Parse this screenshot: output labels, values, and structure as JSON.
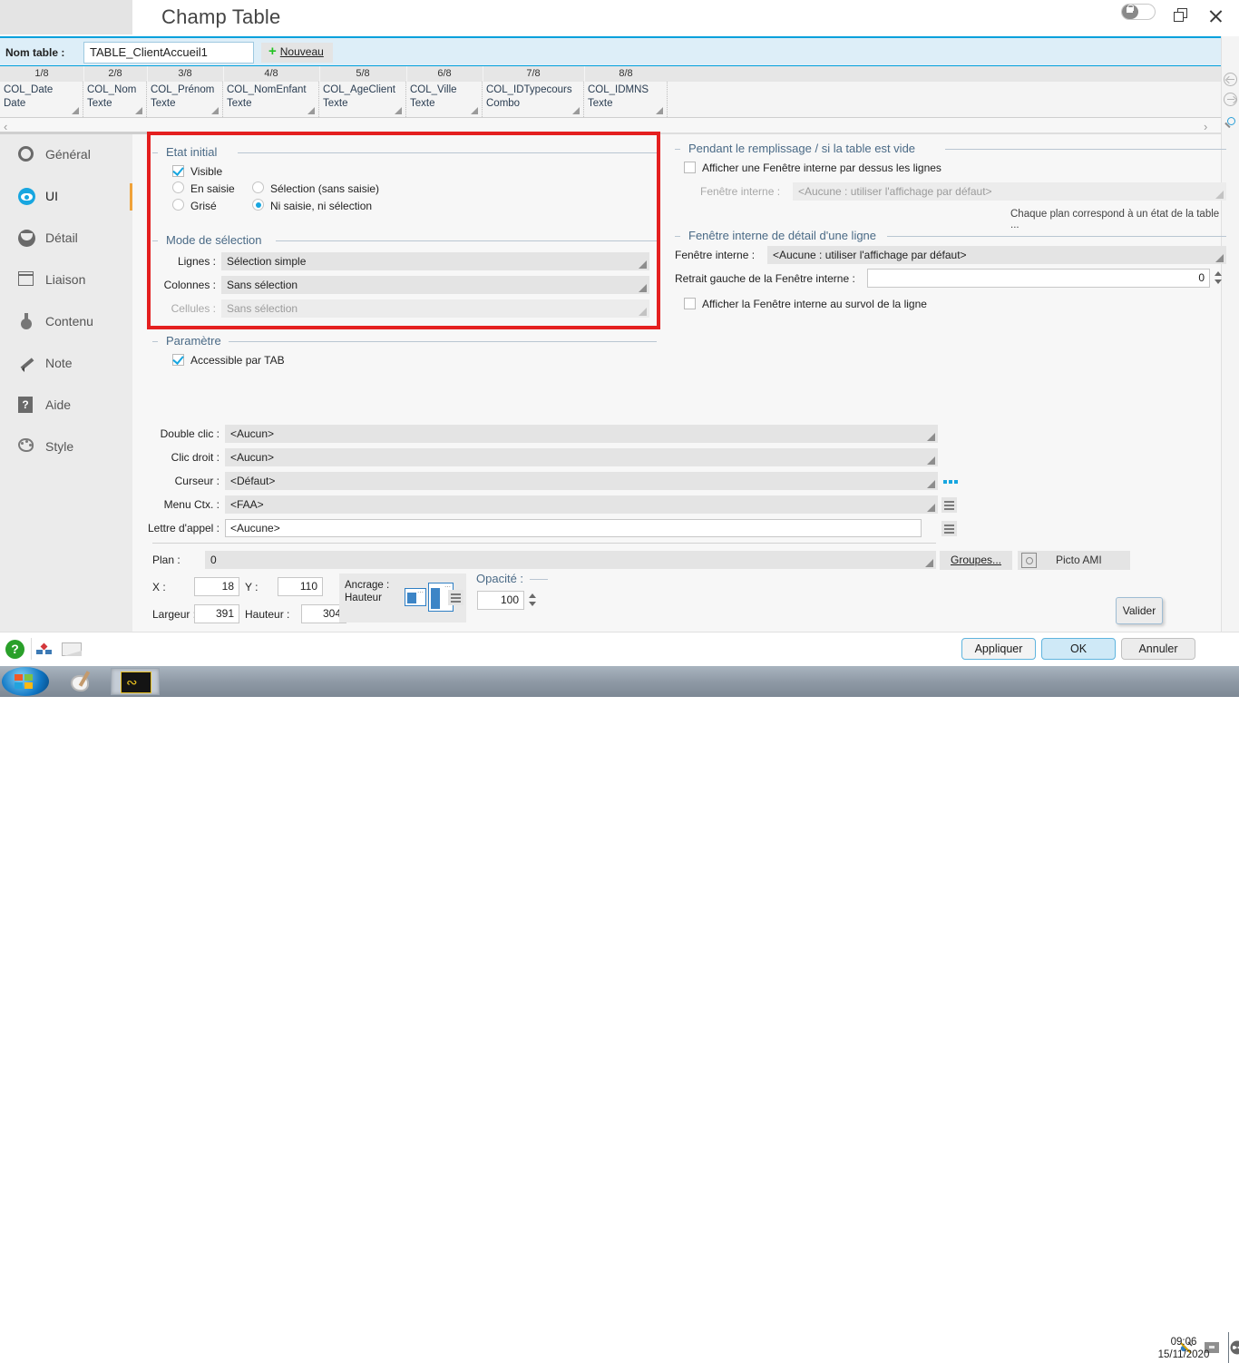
{
  "window": {
    "title": "Champ Table",
    "lock_icon": "lock-toggle",
    "restore_icon": "restore-icon",
    "close_icon": "close-icon"
  },
  "namebar": {
    "label": "Nom table :",
    "value": "TABLE_ClientAccueil1",
    "new_button": "Nouveau"
  },
  "columns": [
    {
      "num": "1/8",
      "name": "COL_Date",
      "type": "Date"
    },
    {
      "num": "2/8",
      "name": "COL_Nom",
      "type": "Texte"
    },
    {
      "num": "3/8",
      "name": "COL_Prénom",
      "type": "Texte"
    },
    {
      "num": "4/8",
      "name": "COL_NomEnfant",
      "type": "Texte"
    },
    {
      "num": "5/8",
      "name": "COL_AgeClient",
      "type": "Texte"
    },
    {
      "num": "6/8",
      "name": "COL_Ville",
      "type": "Texte"
    },
    {
      "num": "7/8",
      "name": "COL_IDTypecours",
      "type": "Combo"
    },
    {
      "num": "8/8",
      "name": "COL_IDMNS",
      "type": "Texte"
    }
  ],
  "sidebar": {
    "items": [
      {
        "label": "Général",
        "icon": "ring-icon",
        "active": false
      },
      {
        "label": "UI",
        "icon": "eye-icon",
        "active": true
      },
      {
        "label": "Détail",
        "icon": "detail-icon",
        "active": false
      },
      {
        "label": "Liaison",
        "icon": "window-icon",
        "active": false
      },
      {
        "label": "Contenu",
        "icon": "flask-icon",
        "active": false
      },
      {
        "label": "Note",
        "icon": "pencil-icon",
        "active": false
      },
      {
        "label": "Aide",
        "icon": "help-icon",
        "active": false
      },
      {
        "label": "Style",
        "icon": "palette-icon",
        "active": false
      }
    ]
  },
  "etat_initial": {
    "legend": "Etat initial",
    "visible": {
      "label": "Visible",
      "checked": true
    },
    "en_saisie": {
      "label": "En saisie",
      "selected": false
    },
    "selection_sans_saisie": {
      "label": "Sélection (sans saisie)",
      "selected": false
    },
    "grise": {
      "label": "Grisé",
      "selected": false
    },
    "ni_saisie_ni_selection": {
      "label": "Ni saisie, ni sélection",
      "selected": true
    }
  },
  "mode_selection": {
    "legend": "Mode de sélection",
    "rows": [
      {
        "label": "Lignes :",
        "value": "Sélection simple",
        "disabled": false
      },
      {
        "label": "Colonnes :",
        "value": "Sans sélection",
        "disabled": false
      },
      {
        "label": "Cellules :",
        "value": "Sans sélection",
        "disabled": true
      }
    ]
  },
  "parametre": {
    "legend": "Paramètre",
    "accessible_tab": {
      "label": "Accessible par TAB",
      "checked": true
    }
  },
  "remplissage": {
    "legend": "Pendant le remplissage / si la table est vide",
    "afficher_fenetre": {
      "label": "Afficher une Fenêtre interne par dessus les lignes",
      "checked": false
    },
    "fenetre_interne_label": "Fenêtre interne :",
    "fenetre_interne_value": "<Aucune : utiliser l'affichage par défaut>",
    "hint": "Chaque plan correspond à un état de la table ..."
  },
  "detail_ligne": {
    "legend": "Fenêtre interne de détail d'une ligne",
    "fenetre_interne_label": "Fenêtre interne :",
    "fenetre_interne_value": "<Aucune : utiliser l'affichage par défaut>",
    "retrait_label": "Retrait gauche de la Fenêtre interne :",
    "retrait_value": "0",
    "survol": {
      "label": "Afficher la Fenêtre interne au survol de la ligne",
      "checked": false
    }
  },
  "events": [
    {
      "label": "Double clic :",
      "value": "<Aucun>",
      "trailing": "none"
    },
    {
      "label": "Clic droit :",
      "value": "<Aucun>",
      "trailing": "none"
    },
    {
      "label": "Curseur :",
      "value": "<Défaut>",
      "trailing": "dots"
    },
    {
      "label": "Menu Ctx. :",
      "value": "<FAA>",
      "trailing": "menu"
    },
    {
      "label": "Lettre d'appel :",
      "value": "<Aucune>",
      "trailing": "menu"
    }
  ],
  "geometry": {
    "plan_label": "Plan :",
    "plan_value": "0",
    "x_label": "X :",
    "x_value": "18",
    "y_label": "Y :",
    "y_value": "110",
    "largeur_label": "Largeur :",
    "largeur_value": "391",
    "hauteur_label": "Hauteur :",
    "hauteur_value": "304",
    "ancrage_label": "Ancrage :",
    "ancrage_value": "Hauteur",
    "opacite_label": "Opacité :",
    "opacite_value": "100",
    "groupes_button": "Groupes...",
    "picto_button": "Picto AMI"
  },
  "valider_button": "Valider",
  "footer": {
    "appliquer": "Appliquer",
    "ok": "OK",
    "annuler": "Annuler"
  },
  "taskbar": {
    "clock_time": "09:06",
    "clock_date": "15/11/2020"
  },
  "colors": {
    "accent": "#17a6e0",
    "highlight_border": "#e41f1f",
    "legend_text": "#4a6a86",
    "namebar_bg": "#ddeef8"
  }
}
